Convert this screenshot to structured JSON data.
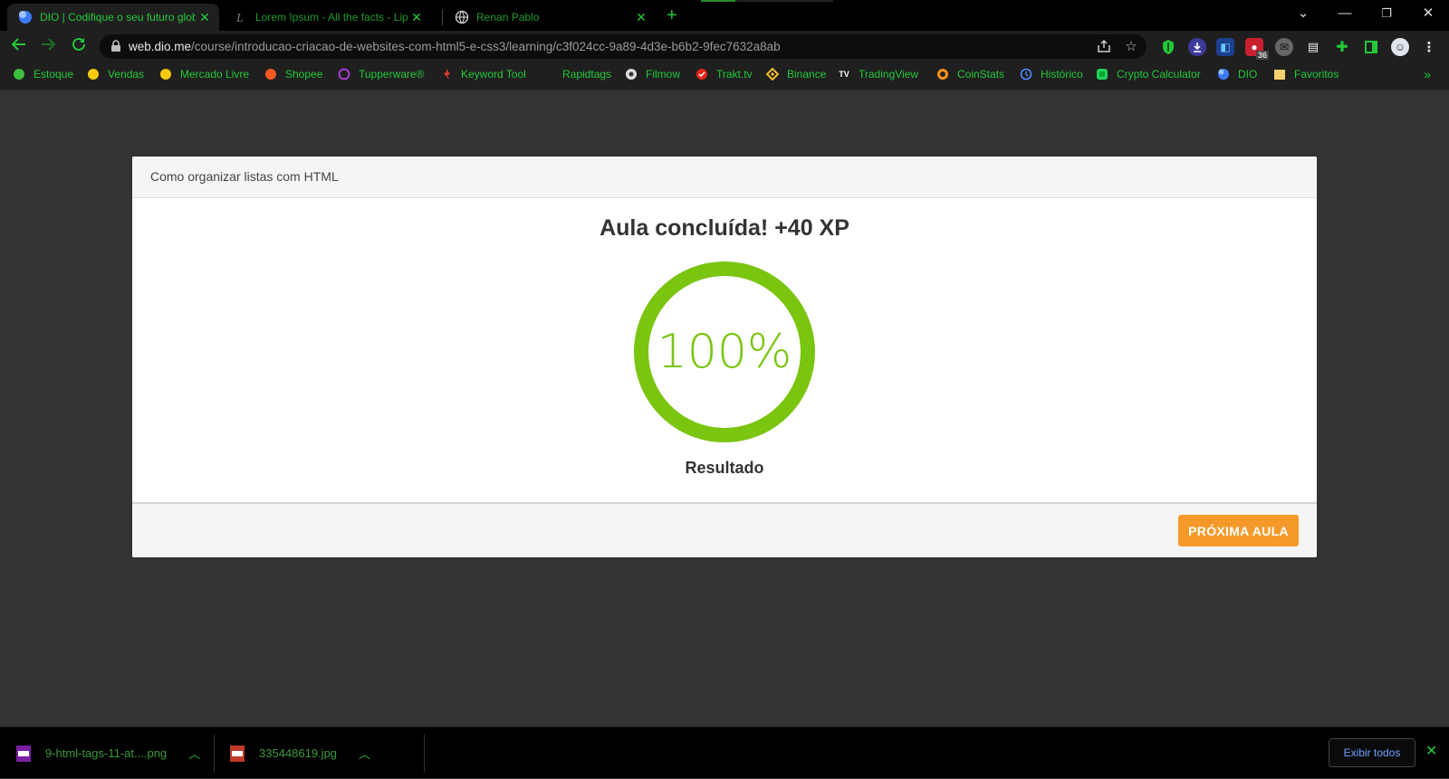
{
  "browser": {
    "tabs": [
      {
        "title": "DIO | Codifique o seu futuro glob",
        "active": true,
        "icon": "dio-icon"
      },
      {
        "title": "Lorem Ipsum - All the facts - Lip",
        "active": false,
        "icon": "lipsum-icon"
      },
      {
        "title": "Renan Pablo",
        "active": false,
        "icon": "globe-icon"
      }
    ],
    "url_host": "web.dio.me",
    "url_path": "/course/introducao-criacao-de-websites-com-html5-e-css3/learning/c3f024cc-9a89-4d3e-b6b2-9fec7632a8ab",
    "extension_badge": "36"
  },
  "bookmarks": [
    {
      "label": "Estoque",
      "icon": "green-circle-icon",
      "color": "#3fbf3f"
    },
    {
      "label": "Vendas",
      "icon": "yellow-circle-icon",
      "color": "#f6c90e"
    },
    {
      "label": "Mercado Livre",
      "icon": "yellow-circle-icon",
      "color": "#f6c90e"
    },
    {
      "label": "Shopee",
      "icon": "orange-circle-icon",
      "color": "#f05a22"
    },
    {
      "label": "Tupperware®",
      "icon": "purple-ring-icon",
      "color": "#a43bd0"
    },
    {
      "label": "Keyword Tool",
      "icon": "keyword-tool-icon",
      "color": "#e03b2b"
    },
    {
      "label": "Rapidtags",
      "icon": "none",
      "color": "#1f1f1f"
    },
    {
      "label": "Filmow",
      "icon": "filmow-icon",
      "color": "#dddddd"
    },
    {
      "label": "Trakt.tv",
      "icon": "trakt-icon",
      "color": "#e3261b"
    },
    {
      "label": "Binance",
      "icon": "binance-icon",
      "color": "#f3ba2f"
    },
    {
      "label": "TradingView",
      "icon": "tradingview-icon",
      "color": "#ffffff"
    },
    {
      "label": "CoinStats",
      "icon": "coinstats-icon",
      "color": "#f7931a"
    },
    {
      "label": "Histórico",
      "icon": "history-icon",
      "color": "#4a8cff"
    },
    {
      "label": "Crypto Calculator",
      "icon": "crypto-calc-icon",
      "color": "#22d35a"
    },
    {
      "label": "DIO",
      "icon": "dio-icon",
      "color": "#4a8cff"
    },
    {
      "label": "Favoritos",
      "icon": "folder-icon",
      "color": "#f4d06f"
    }
  ],
  "lesson": {
    "title": "Como organizar listas com HTML",
    "completed_message": "Aula concluída! +40 XP",
    "progress_percent": 100,
    "progress_text": "100%",
    "result_label": "Resultado",
    "next_button": "PRÓXIMA AULA"
  },
  "colors": {
    "accent_green": "#23c93a",
    "progress_green": "#7ac510",
    "button_orange": "#f59a2a",
    "page_bg": "#333333"
  },
  "downloads": {
    "items": [
      {
        "filename": "9-html-tags-11-at....png",
        "type": "PNG"
      },
      {
        "filename": "335448619.jpg",
        "type": "JPG"
      }
    ],
    "show_all": "Exibir todos"
  }
}
